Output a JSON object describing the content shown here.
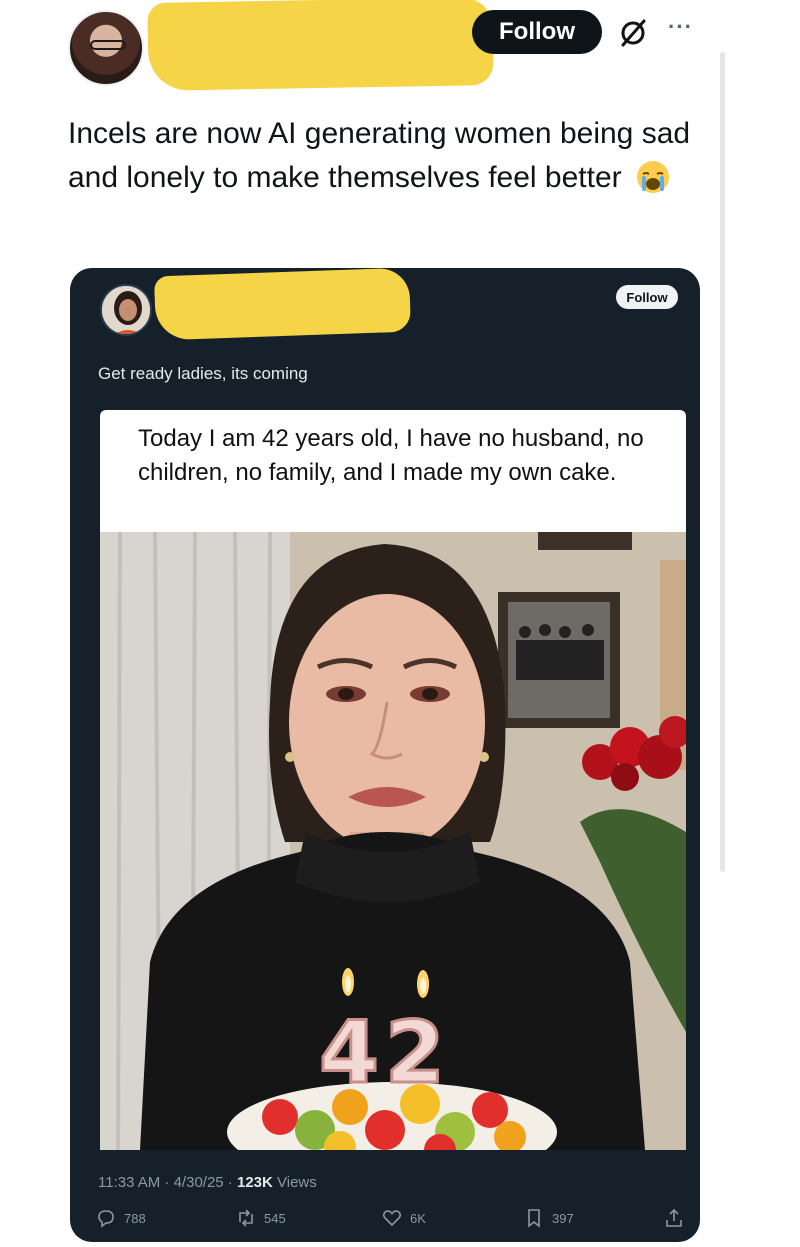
{
  "post": {
    "follow_label": "Follow",
    "more_label": "···",
    "text": "Incels are now AI generating women being sad and lonely to make themselves feel better"
  },
  "quoted": {
    "follow_label": "Follow",
    "caption": "Get ready ladies, its coming",
    "image_text": "Today I am 42 years old, I have no husband, no children, no family, and I made my own cake.",
    "candle_number": "42",
    "time": "11:33 AM · 4/30/25 ·",
    "views_count": "123K",
    "views_label": "Views",
    "stats": {
      "replies": "788",
      "reposts": "545",
      "likes": "6K",
      "bookmarks": "397"
    }
  },
  "icons": [
    "grok-icon",
    "more-icon",
    "crying-emoji-icon",
    "reply-icon",
    "repost-icon",
    "like-icon",
    "bookmark-icon",
    "share-icon"
  ],
  "colors": {
    "card_bg": "#15202b",
    "redaction": "#f5d547",
    "follow_dark": "#0f1419",
    "muted": "#8b98a5"
  }
}
